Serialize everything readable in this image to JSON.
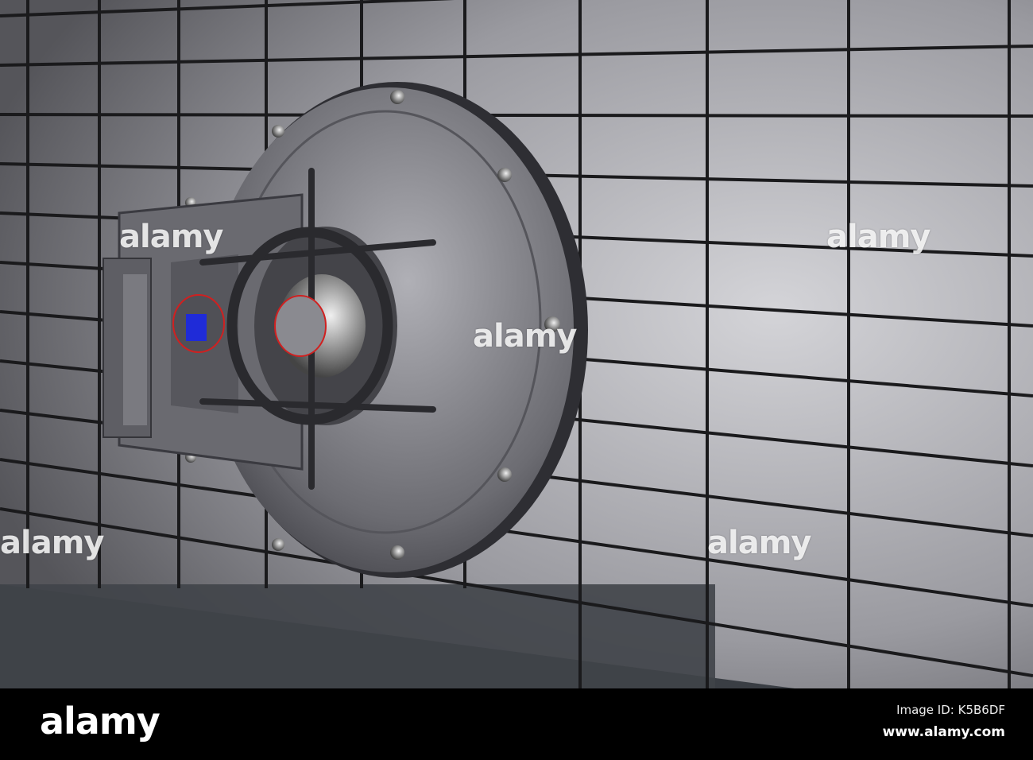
{
  "watermark": "alamy",
  "footer": {
    "logo": "alamy",
    "image_id": "Image ID: K5B6DF",
    "website": "www.alamy.com"
  },
  "colors": {
    "screen": "#1f2bd8",
    "ring": "#d02020",
    "wall": "#8f8f94",
    "grout": "#1a1a1c"
  }
}
